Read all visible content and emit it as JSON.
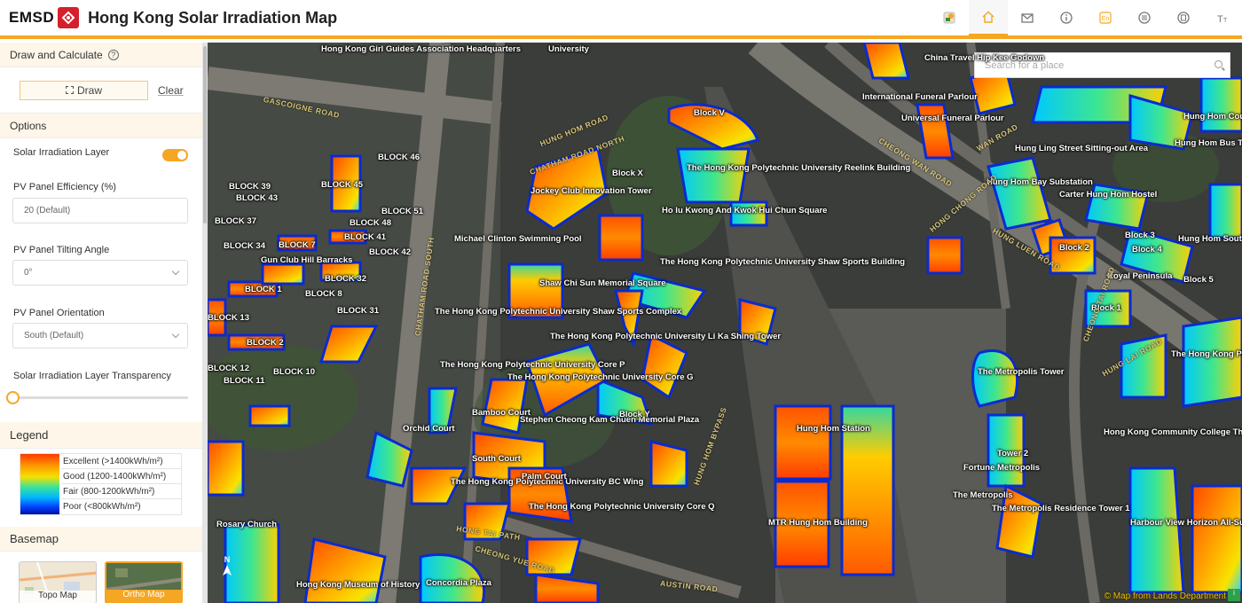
{
  "header": {
    "logo_text": "EMSD",
    "title": "Hong Kong Solar Irradiation Map",
    "icons": [
      "layers-icon",
      "home-icon",
      "mail-icon",
      "info-icon",
      "language-en-icon",
      "menu-list-icon",
      "document-icon",
      "font-size-icon"
    ],
    "lang_label": "En"
  },
  "sidebar": {
    "draw_section": {
      "title": "Draw and Calculate",
      "draw_label": "Draw",
      "clear_label": "Clear"
    },
    "options": {
      "title": "Options",
      "layer_label": "Solar Irradiation Layer",
      "layer_on": true,
      "efficiency_label": "PV Panel Efficiency (%)",
      "efficiency_value": "20  (Default)",
      "tilt_label": "PV Panel Tilting Angle",
      "tilt_value": "0°",
      "orientation_label": "PV Panel Orientation",
      "orientation_value": "South (Default)",
      "transparency_label": "Solar Irradiation Layer Transparency",
      "transparency_value": 0
    },
    "legend": {
      "title": "Legend",
      "items": [
        "Excellent (>1400kWh/m²)",
        "Good (1200-1400kWh/m²)",
        "Fair (800-1200kWh/m²)",
        "Poor (<800kWh/m²)"
      ],
      "colors": [
        "#ff3a00",
        "#f5e000",
        "#3be39a",
        "#0040ff"
      ]
    },
    "basemap": {
      "title": "Basemap",
      "options": [
        "Topo Map",
        "Ortho Map"
      ],
      "selected": "Ortho Map"
    }
  },
  "map": {
    "search_placeholder": "Search for a place",
    "north_label": "N",
    "attribution": "© Map from Lands Department",
    "labels": [
      "Hong Kong Girl Guides Association Headquarters",
      "University",
      "Block V",
      "Block X",
      "BLOCK 46",
      "BLOCK 39",
      "BLOCK 43",
      "BLOCK 45",
      "BLOCK 51",
      "BLOCK 37",
      "BLOCK 48",
      "BLOCK 41",
      "BLOCK 34",
      "BLOCK 7",
      "BLOCK 42",
      "Gun Club Hill Barracks",
      "BLOCK 1",
      "BLOCK 8",
      "BLOCK 32",
      "BLOCK 31",
      "BLOCK 2",
      "BLOCK 10",
      "BLOCK 11",
      "BLOCK 12",
      "BLOCK 13",
      "Jockey Club Innovation Tower",
      "The Hong Kong Polytechnic University Reelink Building",
      "Ho Iu Kwong And Kwok Hui Chun Square",
      "Michael Clinton Swimming Pool",
      "The Hong Kong Polytechnic University Shaw Sports Complex",
      "Shaw Chi Sun Memorial Square",
      "The Hong Kong Polytechnic University Shaw Sports Building",
      "The Hong Kong Polytechnic University Li Ka Shing Tower",
      "The Hong Kong Polytechnic University Core P",
      "The Hong Kong Polytechnic University Core G",
      "Bamboo Court",
      "Stephen Cheong Kam Chuen Memorial Plaza",
      "Orchid Court",
      "South Court",
      "The Hong Kong Polytechnic University BC Wing",
      "Palm Court",
      "The Hong Kong Polytechnic University Core Q",
      "Block Y",
      "Hung Hom Station",
      "MTR Hung Hom Building",
      "The Metropolis Tower",
      "Tower 2",
      "Fortune Metropolis",
      "The Metropolis",
      "The Metropolis Residence Tower 1",
      "Harbour View Horizon All-Suite Hotel",
      "Hong Kong Community College The Hong Kong Polytechnic University",
      "The Hong Kong Polytechnic University Student Halls of Residence",
      "Hung Ling Street Sitting-out Area",
      "Hung Hom Bay Substation",
      "Carter Hung Hom Hostel",
      "Block 1",
      "Block 2",
      "Block 3",
      "Block 4",
      "Block 5",
      "Royal Peninsula",
      "Hung Hom South Road Rest Garden",
      "China Travel Hip Kee Godown",
      "International Funeral Parlour",
      "Universal Funeral Parlour",
      "Rosary Church",
      "Concordia Plaza",
      "Hong Kong Museum of History",
      "Hung Hom Court",
      "Hung Hom Bus Terminus"
    ],
    "roads": [
      "GASCOIGNE ROAD",
      "HUNG HOM ROAD",
      "CHATHAM ROAD SOUTH",
      "CHEONG WAN ROAD",
      "HONG CHONG ROAD",
      "HUNG LUEN ROAD",
      "CHATHAM ROAD NORTH",
      "WAN ROAD",
      "CHEONG TAI ROAD",
      "HUNG LAI ROAD",
      "HONG TAI PATH",
      "CHEONG YUE ROAD",
      "AUSTIN ROAD",
      "HUNG HOM BYPASS"
    ]
  }
}
